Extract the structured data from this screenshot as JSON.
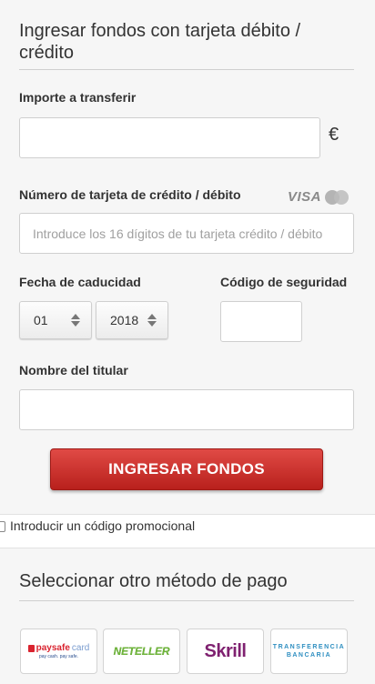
{
  "form": {
    "title": "Ingresar fondos con tarjeta débito / crédito",
    "amount_label": "Importe a transferir",
    "amount_value": "",
    "currency_symbol": "€",
    "card_label": "Número de tarjeta de crédito / débito",
    "card_logos": {
      "visa": "VISA",
      "mastercard": "MasterCard"
    },
    "card_placeholder": "Introduce los 16 dígitos de tu tarjeta crédito / débito",
    "card_value": "",
    "expiry_label": "Fecha de caducidad",
    "expiry_month": "01",
    "expiry_year": "2018",
    "cvv_label": "Código de seguridad",
    "cvv_value": "",
    "holder_label": "Nombre del titular",
    "holder_value": "",
    "submit_label": "INGRESAR FONDOS"
  },
  "promo": {
    "checkbox_label": "Introducir un código promocional",
    "checked": false
  },
  "payment_methods": {
    "title": "Seleccionar otro método de pago",
    "items": [
      {
        "name": "paysafecard",
        "text_a": "paysafe",
        "text_b": "card",
        "tagline": "pay cash. pay safe."
      },
      {
        "name": "neteller",
        "text": "NETELLER"
      },
      {
        "name": "skrill",
        "text": "Skrill"
      },
      {
        "name": "transferencia",
        "line1": "TRANSFERENCIA",
        "line2": "BANCARIA"
      }
    ]
  },
  "colors": {
    "submit_top": "#e04a45",
    "submit_bottom": "#b8201c",
    "neteller": "#6fb53b",
    "skrill": "#7f2170",
    "transferencia": "#2f8fc1"
  }
}
